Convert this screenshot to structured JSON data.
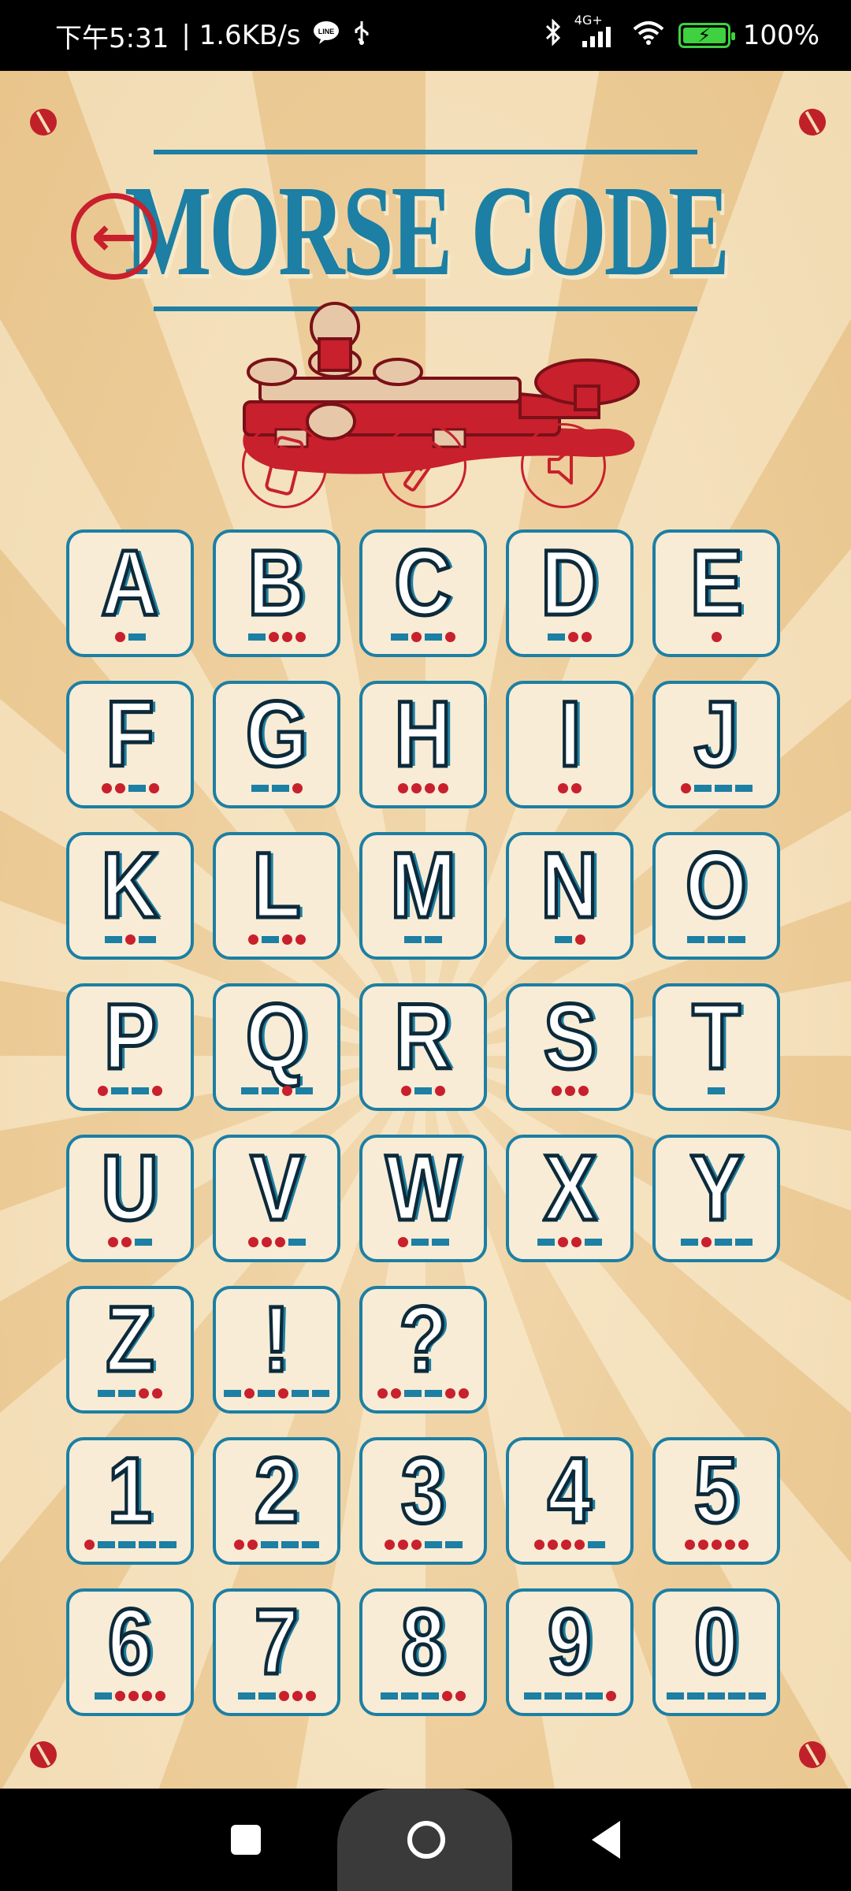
{
  "status_bar": {
    "time": "下午5:31",
    "net_speed": "| 1.6KB/s",
    "network_type": "4G+",
    "battery_percent": "100%",
    "icons": [
      "line-icon",
      "usb-icon",
      "bluetooth-icon",
      "signal-icon",
      "wifi-icon",
      "battery-icon"
    ]
  },
  "header": {
    "back_icon": "←",
    "logo_title": "MORSE CODE"
  },
  "mode_buttons": [
    {
      "name": "phone-vibrate-button",
      "icon": "phone-icon"
    },
    {
      "name": "flashlight-button",
      "icon": "flashlight-icon"
    },
    {
      "name": "sound-button",
      "icon": "speaker-icon"
    }
  ],
  "characters": [
    {
      "char": "A",
      "code": ".-"
    },
    {
      "char": "B",
      "code": "-..."
    },
    {
      "char": "C",
      "code": "-.-."
    },
    {
      "char": "D",
      "code": "-.."
    },
    {
      "char": "E",
      "code": "."
    },
    {
      "char": "F",
      "code": "..-."
    },
    {
      "char": "G",
      "code": "--."
    },
    {
      "char": "H",
      "code": "...."
    },
    {
      "char": "I",
      "code": ".."
    },
    {
      "char": "J",
      "code": ".---"
    },
    {
      "char": "K",
      "code": "-.-"
    },
    {
      "char": "L",
      "code": ".-.."
    },
    {
      "char": "M",
      "code": "--"
    },
    {
      "char": "N",
      "code": "-."
    },
    {
      "char": "O",
      "code": "---"
    },
    {
      "char": "P",
      "code": ".--."
    },
    {
      "char": "Q",
      "code": "--.-"
    },
    {
      "char": "R",
      "code": ".-."
    },
    {
      "char": "S",
      "code": "..."
    },
    {
      "char": "T",
      "code": "-"
    },
    {
      "char": "U",
      "code": "..-"
    },
    {
      "char": "V",
      "code": "...-"
    },
    {
      "char": "W",
      "code": ".--"
    },
    {
      "char": "X",
      "code": "-..-"
    },
    {
      "char": "Y",
      "code": "-.--"
    },
    {
      "char": "Z",
      "code": "--.."
    },
    {
      "char": "!",
      "code": "-.-.--"
    },
    {
      "char": "?",
      "code": "..--.."
    },
    null,
    null,
    {
      "char": "1",
      "code": ".----"
    },
    {
      "char": "2",
      "code": "..---"
    },
    {
      "char": "3",
      "code": "...--"
    },
    {
      "char": "4",
      "code": "....-"
    },
    {
      "char": "5",
      "code": "....."
    },
    {
      "char": "6",
      "code": "-...."
    },
    {
      "char": "7",
      "code": "--..."
    },
    {
      "char": "8",
      "code": "---.."
    },
    {
      "char": "9",
      "code": "----."
    },
    {
      "char": "0",
      "code": "-----"
    }
  ],
  "colors": {
    "accent_red": "#c8202c",
    "accent_blue": "#1c7fa3",
    "tile_bg": "#f8ecd6"
  }
}
